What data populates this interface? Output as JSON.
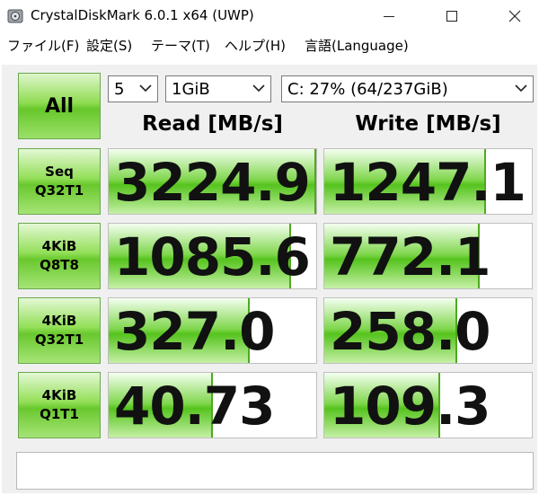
{
  "window": {
    "title": "CrystalDiskMark 6.0.1 x64 (UWP)",
    "icon": "app-disk-icon"
  },
  "menu": [
    "ファイル(F)",
    "設定(S)",
    "テーマ(T)",
    "ヘルプ(H)",
    "言語(Language)"
  ],
  "controls": {
    "all_label": "All",
    "count": "5",
    "size": "1GiB",
    "drive": "C: 27% (64/237GiB)"
  },
  "headers": {
    "read": "Read [MB/s]",
    "write": "Write [MB/s]"
  },
  "rows": [
    {
      "line1": "Seq",
      "line2": "Q32T1",
      "read": "3224.9",
      "write": "1247.1",
      "read_fill": 1.0,
      "write_fill": 0.78
    },
    {
      "line1": "4KiB",
      "line2": "Q8T8",
      "read": "1085.6",
      "write": "772.1",
      "read_fill": 0.88,
      "write_fill": 0.75
    },
    {
      "line1": "4KiB",
      "line2": "Q32T1",
      "read": "327.0",
      "write": "258.0",
      "read_fill": 0.68,
      "write_fill": 0.64
    },
    {
      "line1": "4KiB",
      "line2": "Q1T1",
      "read": "40.73",
      "write": "109.3",
      "read_fill": 0.5,
      "write_fill": 0.56
    }
  ],
  "comment": "",
  "colors": {
    "accent": "#67c72a",
    "fill_border": "#4fa81f"
  }
}
